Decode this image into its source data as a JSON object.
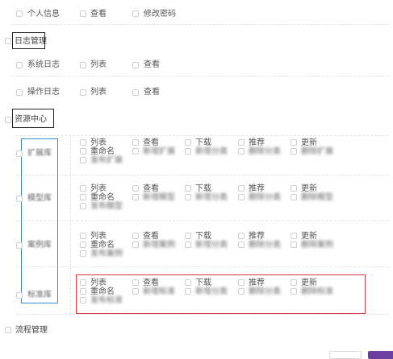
{
  "row_personal": {
    "items": [
      "个人信息",
      "查看",
      "修改密码"
    ]
  },
  "group_log": {
    "title": "日志管理",
    "rows": [
      [
        "系统日志",
        "列表",
        "查看"
      ],
      [
        "操作日志",
        "列表",
        "查看"
      ]
    ]
  },
  "group_resource": {
    "title": "资源中心",
    "subrows": [
      {
        "name": "扩展库",
        "perms": [
          "列表",
          "查看",
          "下载",
          "推荐",
          "更新",
          "重命名",
          "新增扩展",
          "新增分类",
          "删除分类",
          "删除扩展",
          "发布扩展"
        ]
      },
      {
        "name": "模型库",
        "perms": [
          "列表",
          "查看",
          "下载",
          "推荐",
          "更新",
          "重命名",
          "新增模型",
          "新增分类",
          "删除分类",
          "删除模型",
          "发布模型"
        ]
      },
      {
        "name": "案例库",
        "perms": [
          "列表",
          "查看",
          "下载",
          "推荐",
          "更新",
          "重命名",
          "新增案例",
          "新增分类",
          "删除分类",
          "删除案例",
          "发布案例"
        ]
      },
      {
        "name": "标准库",
        "perms": [
          "列表",
          "查看",
          "下载",
          "推荐",
          "更新",
          "重命名",
          "新增标准",
          "新增分类",
          "删除分类",
          "删除标准",
          "发布标准"
        ]
      }
    ]
  },
  "group_flow": {
    "title": "流程管理"
  },
  "colors": {
    "highlight_red": "#d9363e",
    "highlight_blue": "#3a8ad6",
    "primary": "#6b3fa0"
  }
}
